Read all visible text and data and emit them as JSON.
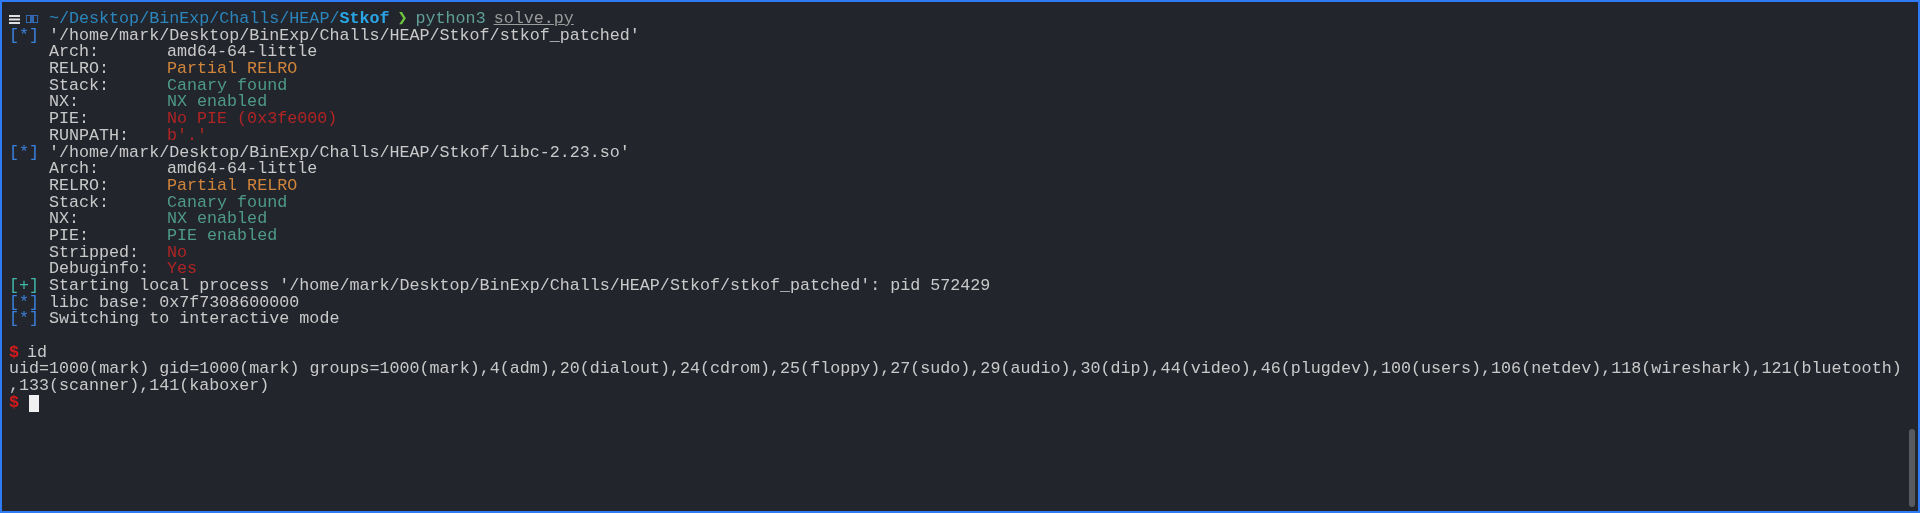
{
  "prompt": {
    "path": "~/Desktop/BinExp/Challs/HEAP/",
    "dir": "Stkof",
    "arrow": "❯",
    "command": "python3",
    "argument": "solve.py"
  },
  "lines": [
    {
      "kind": "status",
      "color": "#3b82e0",
      "marker": "[*]",
      "text": "'/home/mark/Desktop/BinExp/Challs/HEAP/Stkof/stkof_patched'"
    },
    {
      "kind": "field",
      "label": "Arch:",
      "value": "amd64-64-little",
      "color": "#c9c9c9"
    },
    {
      "kind": "field",
      "label": "RELRO:",
      "value": "Partial RELRO",
      "color": "#d0853b"
    },
    {
      "kind": "field",
      "label": "Stack:",
      "value": "Canary found",
      "color": "#4e9a88"
    },
    {
      "kind": "field",
      "label": "NX:",
      "value": "NX enabled",
      "color": "#4e9a88"
    },
    {
      "kind": "field",
      "label": "PIE:",
      "value": "No PIE (0x3fe000)",
      "color": "#b02424"
    },
    {
      "kind": "field",
      "label": "RUNPATH:",
      "value": "b'.'",
      "color": "#b02424"
    },
    {
      "kind": "status",
      "color": "#3b82e0",
      "marker": "[*]",
      "text": "'/home/mark/Desktop/BinExp/Challs/HEAP/Stkof/libc-2.23.so'"
    },
    {
      "kind": "field",
      "label": "Arch:",
      "value": "amd64-64-little",
      "color": "#c9c9c9"
    },
    {
      "kind": "field",
      "label": "RELRO:",
      "value": "Partial RELRO",
      "color": "#d0853b"
    },
    {
      "kind": "field",
      "label": "Stack:",
      "value": "Canary found",
      "color": "#4e9a88"
    },
    {
      "kind": "field",
      "label": "NX:",
      "value": "NX enabled",
      "color": "#4e9a88"
    },
    {
      "kind": "field",
      "label": "PIE:",
      "value": "PIE enabled",
      "color": "#4e9a88"
    },
    {
      "kind": "field",
      "label": "Stripped:",
      "value": "No",
      "color": "#b02424"
    },
    {
      "kind": "field",
      "label": "Debuginfo:",
      "value": "Yes",
      "color": "#b02424"
    },
    {
      "kind": "status",
      "color": "#3fb8a8",
      "marker": "[+]",
      "text": "Starting local process '/home/mark/Desktop/BinExp/Challs/HEAP/Stkof/stkof_patched': pid 572429"
    },
    {
      "kind": "status",
      "color": "#3b82e0",
      "marker": "[*]",
      "text": "libc base: 0x7f7308600000"
    },
    {
      "kind": "status",
      "color": "#3b82e0",
      "marker": "[*]",
      "text": "Switching to interactive mode"
    },
    {
      "kind": "blank"
    },
    {
      "kind": "shell",
      "sign": "$",
      "command": "id"
    },
    {
      "kind": "text",
      "text": "uid=1000(mark) gid=1000(mark) groups=1000(mark),4(adm),20(dialout),24(cdrom),25(floppy),27(sudo),29(audio),30(dip),44(video),46(plugdev),100(users),106(netdev),118(wireshark),121(bluetooth)"
    },
    {
      "kind": "text",
      "text": ",133(scanner),141(kaboxer)"
    },
    {
      "kind": "shell",
      "sign": "$",
      "cursor": true
    }
  ]
}
